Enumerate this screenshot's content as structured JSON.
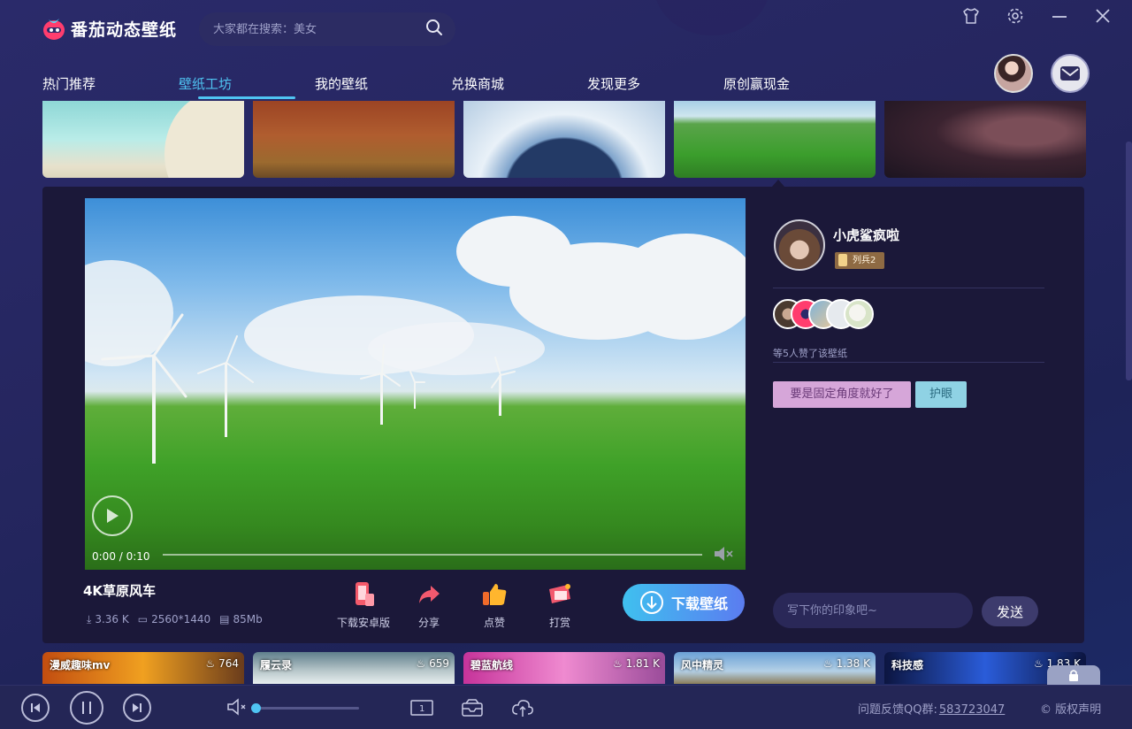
{
  "app": {
    "name": "番茄动态壁纸",
    "brand_color": "#ff3d6e",
    "accent_color": "#4fc4f2"
  },
  "search": {
    "placeholder": "大家都在搜索：美女",
    "icon": "search-icon"
  },
  "window_controls": [
    "skin-icon",
    "settings-icon",
    "minimize-icon",
    "close-icon"
  ],
  "nav": {
    "items": [
      {
        "label": "热门推荐",
        "active": false
      },
      {
        "label": "壁纸工坊",
        "active": true
      },
      {
        "label": "我的壁纸",
        "active": false
      },
      {
        "label": "兑换商城",
        "active": false
      },
      {
        "label": "发现更多",
        "active": false
      },
      {
        "label": "原创赢现金",
        "active": false
      }
    ]
  },
  "detail": {
    "video": {
      "time": "0:00 / 0:10",
      "progress": 0
    },
    "title": "4K草原风车",
    "meta": {
      "size": "3.36 K",
      "resolution": "2560*1440",
      "file_size": "85Mb"
    },
    "actions": [
      {
        "label": "下载安卓版",
        "icon": "phone-icon"
      },
      {
        "label": "分享",
        "icon": "share-icon"
      },
      {
        "label": "点赞",
        "icon": "thumbs-up-icon"
      },
      {
        "label": "打赏",
        "icon": "gift-icon"
      }
    ],
    "download_label": "下载壁纸",
    "author": {
      "name": "小虎鲨疯啦",
      "rank": "列兵2"
    },
    "likes_text": "等5人赞了该壁纸",
    "tags": [
      "要是固定角度就好了",
      "护眼"
    ],
    "comment": {
      "placeholder": "写下你的印象吧~",
      "send_label": "发送"
    }
  },
  "bottom_thumbs": [
    {
      "name": "漫威趣味mv",
      "count": "764"
    },
    {
      "name": "履云录",
      "count": "659"
    },
    {
      "name": "碧蓝航线",
      "count": "1.81 K"
    },
    {
      "name": "风中精灵",
      "count": "1.38 K"
    },
    {
      "name": "科技感",
      "count": "1.83 K"
    }
  ],
  "footer": {
    "feedback_label": "问题反馈QQ群:",
    "qq_group": "583723047",
    "copyright": "© 版权声明",
    "volume": 0
  }
}
